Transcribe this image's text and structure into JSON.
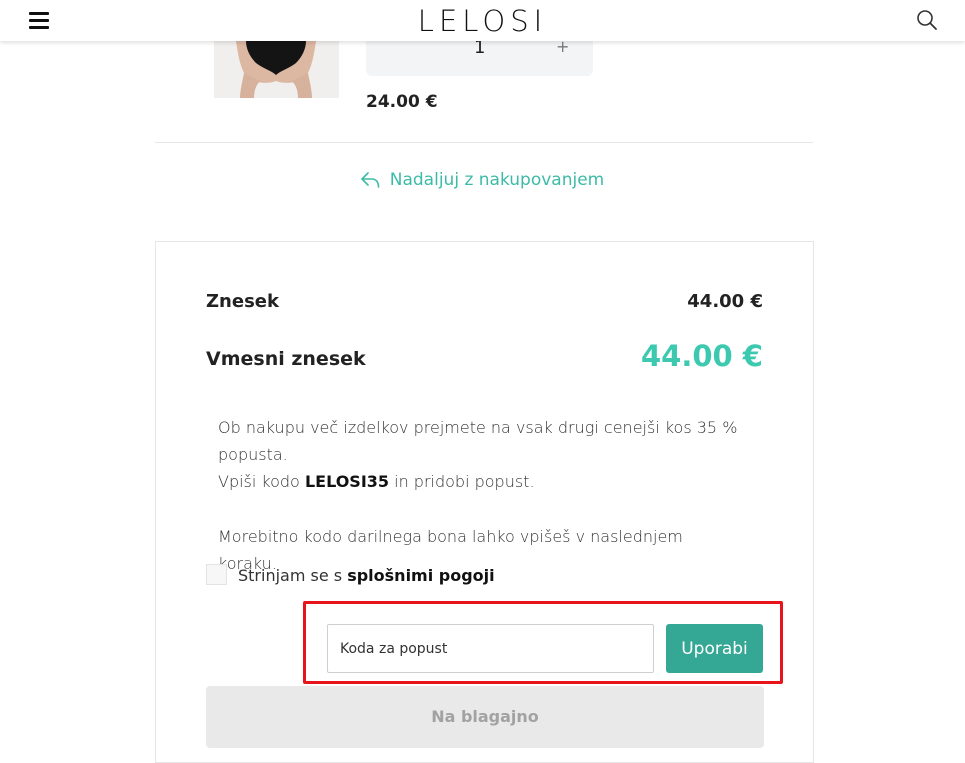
{
  "header": {
    "logo": "LELOSI",
    "menu_icon": "hamburger-menu-icon",
    "search_icon": "search-icon"
  },
  "product": {
    "quantity": "1",
    "plus": "+",
    "price": "24.00 €"
  },
  "continue_shopping": {
    "label": "Nadaljuj z nakupovanjem",
    "icon": "reply-arrow-icon"
  },
  "summary": {
    "amount_label": "Znesek",
    "amount_value": "44.00 €",
    "subtotal_label": "Vmesni znesek",
    "subtotal_value": "44.00 €"
  },
  "info": {
    "line1": "Ob nakupu več izdelkov prejmete na vsak drugi cenejši kos 35 % popusta.",
    "line2_pre": "Vpiši kodo ",
    "line2_code": "LELOSI35",
    "line2_post": " in pridobi popust.",
    "line3": "Morebitno kodo darilnega bona lahko vpišeš v naslednjem koraku."
  },
  "terms": {
    "pre": "Strinjam se s ",
    "link": "splošnimi pogoji"
  },
  "discount": {
    "placeholder": "Koda za popust",
    "apply_label": "Uporabi"
  },
  "checkout": {
    "label": "Na blagajno"
  },
  "colors": {
    "accent": "#3dc9b0",
    "button": "#35a895",
    "highlight": "#e8141c"
  }
}
